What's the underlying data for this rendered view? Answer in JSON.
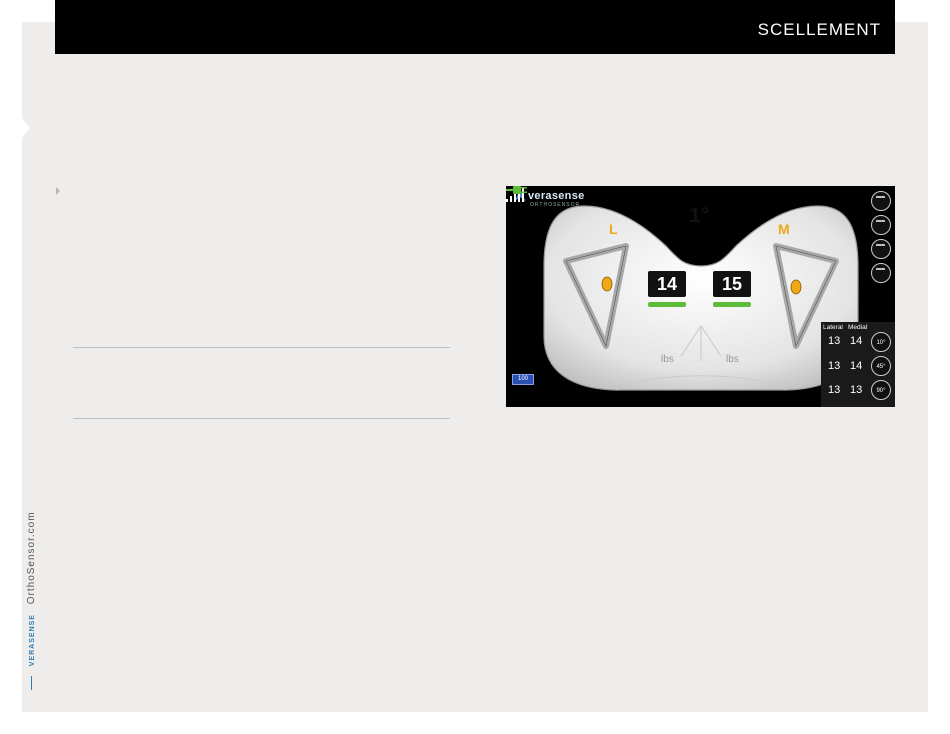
{
  "header": {
    "title": "SCELLEMENT"
  },
  "sidebar": {
    "brand": "VERASENSE",
    "website": "OrthoSensor.com"
  },
  "device": {
    "logo": {
      "name": "verasense",
      "subtitle": "ORTHOSENSOR"
    },
    "angle": "1°",
    "lateral_label": "L",
    "medial_label": "M",
    "lateral_load": "14",
    "medial_load": "15",
    "unit_left": "lbs",
    "unit_right": "lbs",
    "table": {
      "headers": [
        "Lateral",
        "Medial"
      ],
      "rows": [
        {
          "lateral": "13",
          "medial": "14",
          "angle": "10°"
        },
        {
          "lateral": "13",
          "medial": "14",
          "angle": "45°"
        },
        {
          "lateral": "13",
          "medial": "13",
          "angle": "90°"
        }
      ]
    },
    "battery": "100",
    "colors": {
      "accent": "#f0a818",
      "load_bar": "#5dbb3a",
      "background": "#000000"
    }
  }
}
